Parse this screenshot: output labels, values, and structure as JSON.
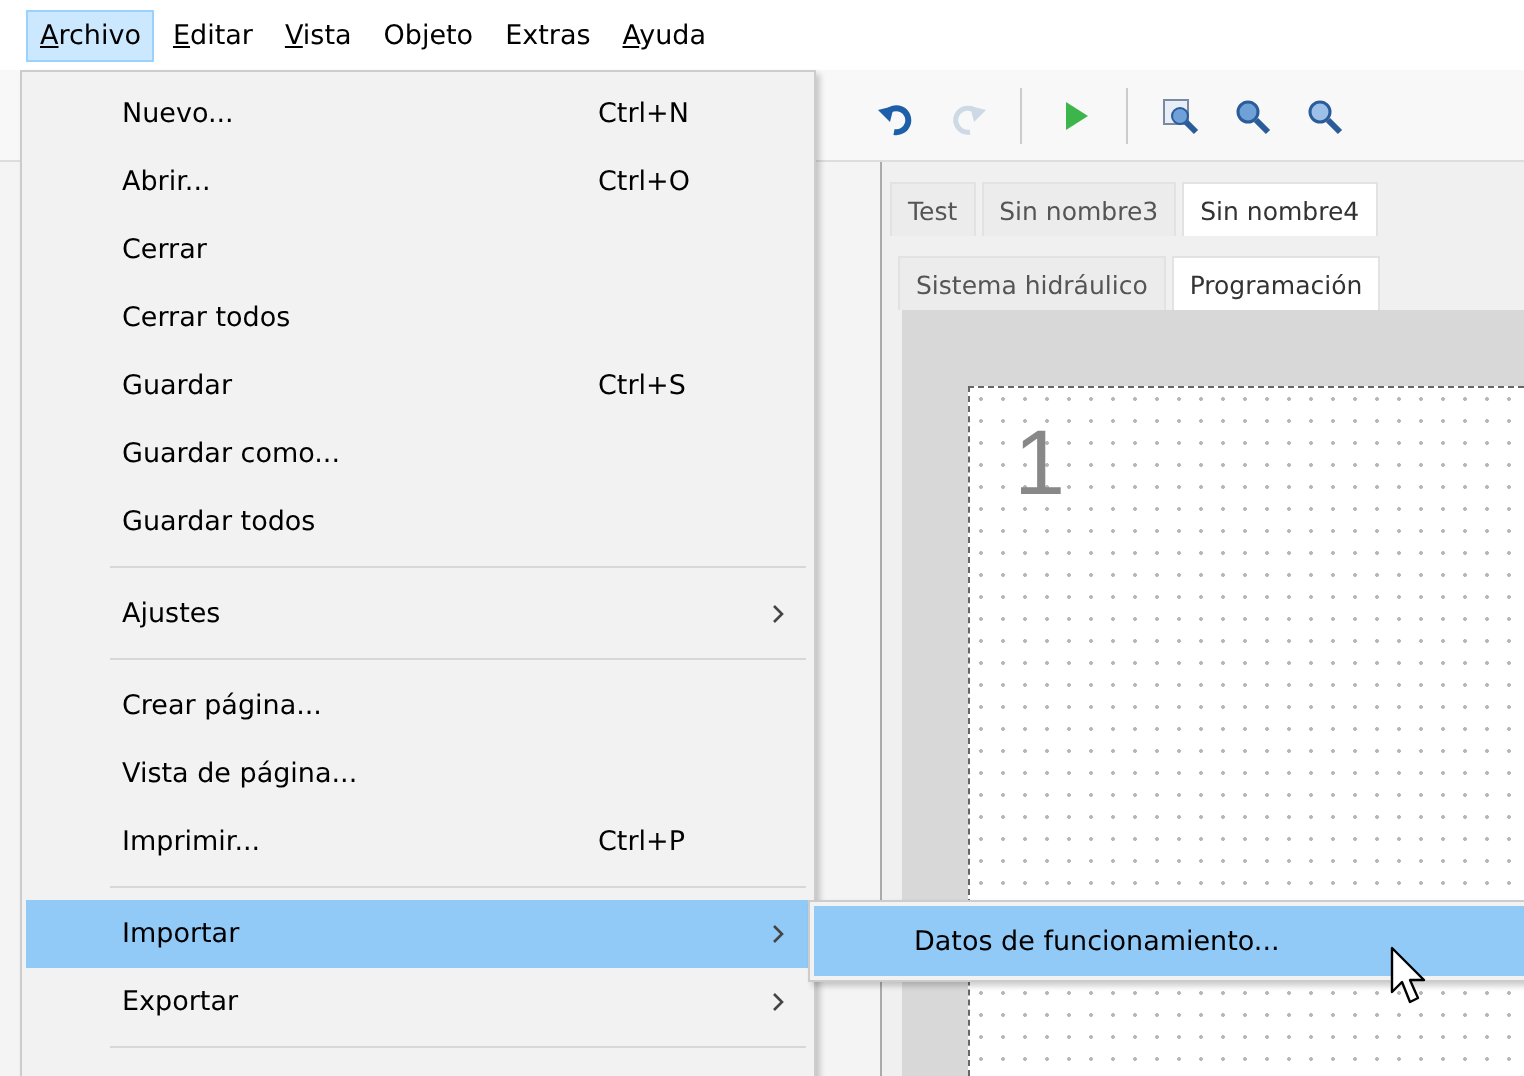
{
  "menubar": [
    {
      "label": "Archivo",
      "mnemonic": true,
      "selected": true
    },
    {
      "label": "Editar",
      "mnemonic": true,
      "selected": false
    },
    {
      "label": "Vista",
      "mnemonic": true,
      "selected": false
    },
    {
      "label": "Objeto",
      "mnemonic": false,
      "selected": false
    },
    {
      "label": "Extras",
      "mnemonic": false,
      "selected": false
    },
    {
      "label": "Ayuda",
      "mnemonic": true,
      "selected": false
    }
  ],
  "toolbar": [
    {
      "kind": "undo",
      "disabled": false
    },
    {
      "kind": "redo",
      "disabled": true
    },
    {
      "kind": "run",
      "disabled": false
    },
    {
      "kind": "zoom-page",
      "disabled": false
    },
    {
      "kind": "zoom-in",
      "disabled": false
    },
    {
      "kind": "zoom-out",
      "disabled": false
    }
  ],
  "document_tabs": [
    {
      "label": "Test",
      "selected": false
    },
    {
      "label": "Sin nombre3",
      "selected": false
    },
    {
      "label": "Sin nombre4",
      "selected": true
    }
  ],
  "view_tabs": [
    {
      "label": "Sistema hidráulico",
      "selected": false
    },
    {
      "label": "Programación",
      "selected": true
    }
  ],
  "canvas": {
    "page_number": "1"
  },
  "menu": {
    "items": [
      {
        "kind": "item",
        "label": "Nuevo...",
        "shortcut": "Ctrl+N",
        "submenu": false,
        "selected": false
      },
      {
        "kind": "item",
        "label": "Abrir...",
        "shortcut": "Ctrl+O",
        "submenu": false,
        "selected": false
      },
      {
        "kind": "item",
        "label": "Cerrar",
        "submenu": false,
        "selected": false
      },
      {
        "kind": "item",
        "label": "Cerrar todos",
        "submenu": false,
        "selected": false
      },
      {
        "kind": "item",
        "label": "Guardar",
        "shortcut": "Ctrl+S",
        "submenu": false,
        "selected": false
      },
      {
        "kind": "item",
        "label": "Guardar como...",
        "submenu": false,
        "selected": false
      },
      {
        "kind": "item",
        "label": "Guardar todos",
        "submenu": false,
        "selected": false
      },
      {
        "kind": "separator"
      },
      {
        "kind": "item",
        "label": "Ajustes",
        "submenu": true,
        "selected": false
      },
      {
        "kind": "separator"
      },
      {
        "kind": "item",
        "label": "Crear página...",
        "submenu": false,
        "selected": false
      },
      {
        "kind": "item",
        "label": "Vista de página...",
        "submenu": false,
        "selected": false
      },
      {
        "kind": "item",
        "label": "Imprimir...",
        "shortcut": "Ctrl+P",
        "submenu": false,
        "selected": false
      },
      {
        "kind": "separator"
      },
      {
        "kind": "item",
        "label": "Importar",
        "submenu": true,
        "selected": true
      },
      {
        "kind": "item",
        "label": "Exportar",
        "submenu": true,
        "selected": false
      },
      {
        "kind": "separator"
      }
    ]
  },
  "submenu": {
    "items": [
      {
        "label": "Datos de funcionamiento...",
        "selected": true
      }
    ]
  }
}
